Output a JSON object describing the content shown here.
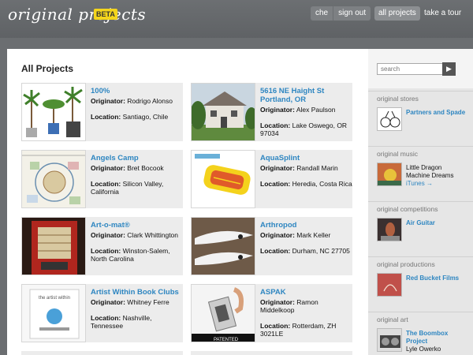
{
  "header": {
    "logo": "original projects",
    "beta": "BETA",
    "nav": {
      "user": "che",
      "sign_out": "sign out",
      "all_projects": "all projects",
      "tour": "take a tour"
    }
  },
  "main": {
    "title": "All Projects",
    "labels": {
      "originator": "Originator:",
      "location": "Location:"
    },
    "projects": [
      {
        "title": "100%",
        "originator": "Rodrigo Alonso",
        "location": "Santiago, Chile"
      },
      {
        "title": "5616 NE Haight St Portland, OR",
        "originator": "Alex Paulson",
        "location": "Lake Oswego, OR 97034"
      },
      {
        "title": "Angels Camp",
        "originator": "Bret Bocook",
        "location": "Silicon Valley, California"
      },
      {
        "title": "AquaSplint",
        "originator": "Randall Marin",
        "location": "Heredia, Costa Rica"
      },
      {
        "title": "Art-o-mat®",
        "originator": "Clark Whittington",
        "location": "Winston-Salem, North Carolina"
      },
      {
        "title": "Arthropod",
        "originator": "Mark Keller",
        "location": "Durham, NC 27705"
      },
      {
        "title": "Artist Within Book Clubs",
        "originator": "Whitney Ferre",
        "location": "Nashville, Tennessee"
      },
      {
        "title": "ASPAK",
        "originator": "Ramon Middelkoop",
        "location": "Rotterdam, ZH 3021LE"
      }
    ],
    "thumb_text": {
      "artist_within": "the artist within",
      "patented": "PATENTED"
    }
  },
  "sidebar": {
    "search": {
      "placeholder": "search",
      "button": "▶"
    },
    "stores": {
      "heading": "original stores",
      "link": "Partners and Spade"
    },
    "music": {
      "heading": "original music",
      "line1": "Little Dragon",
      "line2": "Machine Dreams",
      "link": "iTunes →"
    },
    "competitions": {
      "heading": "original competitions",
      "link": "Air Guitar"
    },
    "productions": {
      "heading": "original productions",
      "link": "Red Bucket Films"
    },
    "art": {
      "heading": "original art",
      "link": "The Boombox Project",
      "text": "Lyle Owerko"
    }
  }
}
